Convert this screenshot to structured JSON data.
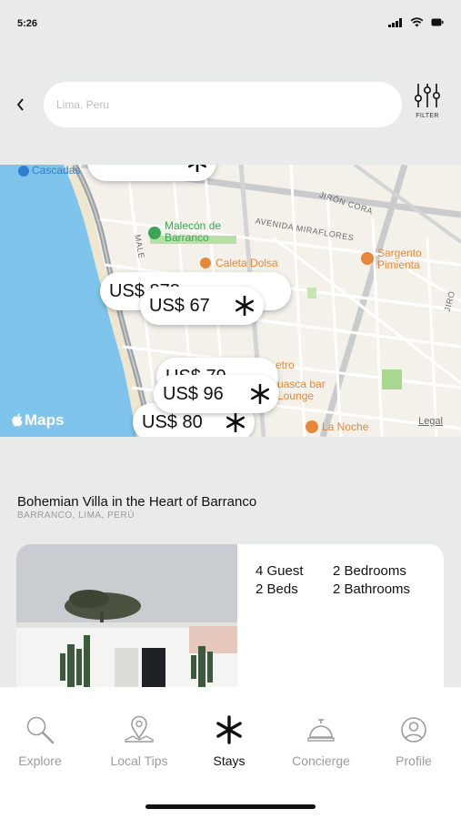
{
  "status_bar": {
    "time": "5:26"
  },
  "search": {
    "placeholder": "Lima, Peru",
    "value": ""
  },
  "filter": {
    "label": "FILTER"
  },
  "map": {
    "places": {
      "cascadas": "Cascadas",
      "malecon": "Malecón de Barranco",
      "caleta": "Caleta Dolsa",
      "sargento": "Sargento Pimienta",
      "huasca": "uasca bar Lounge",
      "retro": "etro",
      "la_noche": "La Noche"
    },
    "streets": {
      "jiron_cora": "JIRÓN CORA",
      "avenida_miraflores": "AVENIDA MIRAFLORES",
      "male": "MALE",
      "jiro": "JIRÓ"
    },
    "price_pins": [
      {
        "label": "US$ 67"
      },
      {
        "label": "US$ 96"
      },
      {
        "label": "US$ 80"
      },
      {
        "label": "US$ 878"
      },
      {
        "label": "US$ 79"
      }
    ],
    "attribution": "Maps",
    "legal": "Legal"
  },
  "listing": {
    "title": "Bohemian Villa in the Heart of Barranco",
    "location": "BARRANCO, LIMA, PERÚ",
    "guests": "4 Guest",
    "bedrooms": "2 Bedrooms",
    "beds": "2 Beds",
    "bathrooms": "2 Bathrooms"
  },
  "tabs": [
    {
      "label": "Explore",
      "icon": "magnifier-icon",
      "active": false
    },
    {
      "label": "Local Tips",
      "icon": "map-pin-icon",
      "active": false
    },
    {
      "label": "Stays",
      "icon": "asterisk-icon",
      "active": true
    },
    {
      "label": "Concierge",
      "icon": "service-bell-icon",
      "active": false
    },
    {
      "label": "Profile",
      "icon": "user-circle-icon",
      "active": false
    }
  ],
  "colors": {
    "background": "#e9eaea",
    "water": "#7ec4ec",
    "park_green": "#3aa655",
    "poi_orange": "#e8873a",
    "inactive_tab": "#9c9c9c"
  }
}
